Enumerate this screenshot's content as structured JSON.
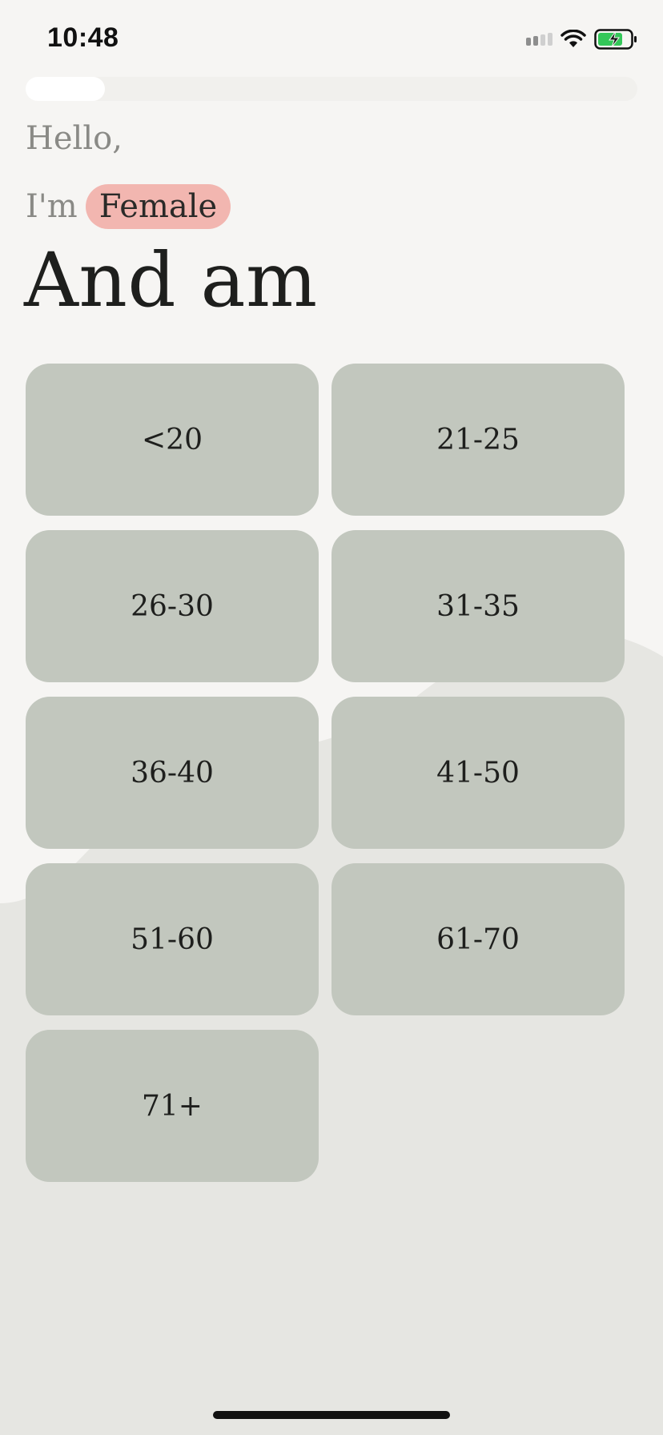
{
  "status_bar": {
    "time": "10:48",
    "signal_icon": "cellular-signal-icon",
    "wifi_icon": "wifi-icon",
    "battery_icon": "battery-charging-icon"
  },
  "progress": {
    "value": 0.13
  },
  "greeting": "Hello,",
  "identity": {
    "prefix": "I'm",
    "gender": "Female"
  },
  "headline": "And am",
  "age_options": [
    {
      "label": "<20"
    },
    {
      "label": "21-25"
    },
    {
      "label": "26-30"
    },
    {
      "label": "31-35"
    },
    {
      "label": "36-40"
    },
    {
      "label": "41-50"
    },
    {
      "label": "51-60"
    },
    {
      "label": "61-70"
    },
    {
      "label": "71+"
    }
  ],
  "colors": {
    "background": "#f6f5f3",
    "background_curve": "#e6e6e2",
    "option_fill": "#c2c7be",
    "gender_chip": "#f2b6b0",
    "battery_green": "#34c759"
  }
}
